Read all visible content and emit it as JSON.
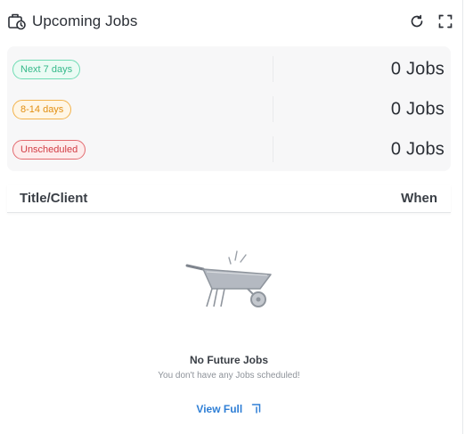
{
  "header": {
    "title": "Upcoming Jobs",
    "title_icon": "briefcase-clock-icon",
    "refresh_icon": "refresh-icon",
    "fullscreen_icon": "fullscreen-icon"
  },
  "summary": {
    "rows": [
      {
        "label": "Next 7 days",
        "count": "0 Jobs",
        "color": "#35b98a"
      },
      {
        "label": "8-14 days",
        "count": "0 Jobs",
        "color": "#e28f12"
      },
      {
        "label": "Unscheduled",
        "count": "0 Jobs",
        "color": "#d23c44"
      }
    ]
  },
  "table": {
    "columns": [
      "Title/Client",
      "When"
    ]
  },
  "empty_state": {
    "illustration": "wheelbarrow-icon",
    "title": "No Future Jobs",
    "subtitle": "You don't have any Jobs scheduled!",
    "link_label": "View Full",
    "link_icon": "external-arrow-icon",
    "link_color": "#2f7fd6"
  }
}
